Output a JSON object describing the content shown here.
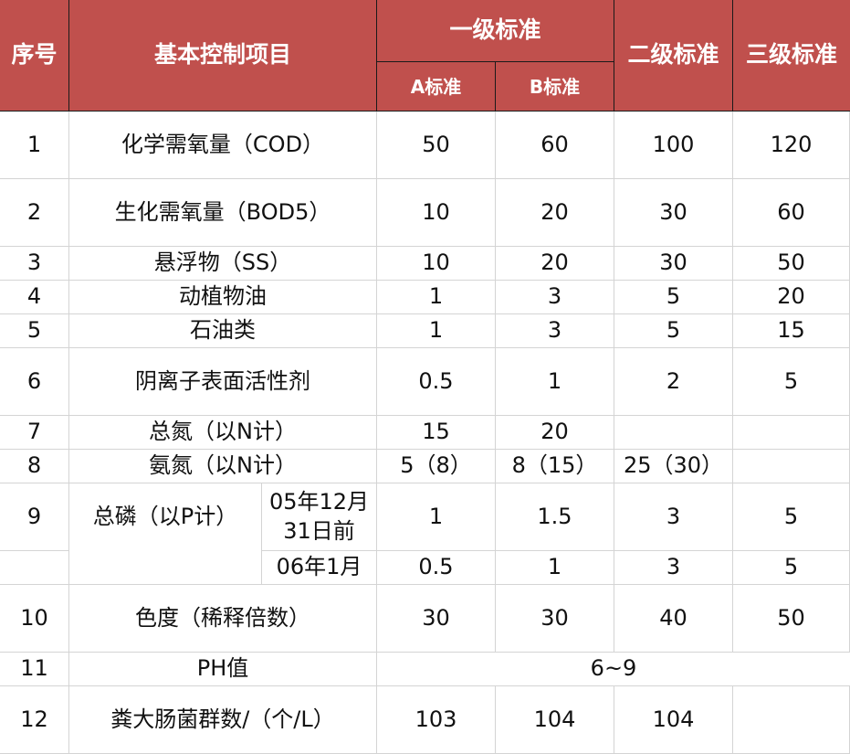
{
  "colors": {
    "header_bg": "#c0504d",
    "header_text": "#ffffff",
    "grid_line": "#d4d4d4",
    "body_text": "#111111"
  },
  "header": {
    "index": "序号",
    "item": "基本控制项目",
    "grade1": "一级标准",
    "grade1_a": "A标准",
    "grade1_b": "B标准",
    "grade2": "二级标准",
    "grade3": "三级标准"
  },
  "rows": [
    {
      "no": "1",
      "item": "化学需氧量（COD）",
      "a": "50",
      "b": "60",
      "g2": "100",
      "g3": "120"
    },
    {
      "no": "2",
      "item": "生化需氧量（BOD5）",
      "a": "10",
      "b": "20",
      "g2": "30",
      "g3": "60"
    },
    {
      "no": "3",
      "item": "悬浮物（SS）",
      "a": "10",
      "b": "20",
      "g2": "30",
      "g3": "50"
    },
    {
      "no": "4",
      "item": "动植物油",
      "a": "1",
      "b": "3",
      "g2": "5",
      "g3": "20"
    },
    {
      "no": "5",
      "item": "石油类",
      "a": "1",
      "b": "3",
      "g2": "5",
      "g3": "15"
    },
    {
      "no": "6",
      "item": "阴离子表面活性剂",
      "a": "0.5",
      "b": "1",
      "g2": "2",
      "g3": "5"
    },
    {
      "no": "7",
      "item": "总氮（以N计）",
      "a": "15",
      "b": "20",
      "g2": "",
      "g3": ""
    },
    {
      "no": "8",
      "item": "氨氮（以N计）",
      "a": "5（8）",
      "b": "8（15）",
      "g2": "25（30）",
      "g3": ""
    },
    {
      "no": "9",
      "item": "总磷（以P计）",
      "sub": "05年12月31日前",
      "a": "1",
      "b": "1.5",
      "g2": "3",
      "g3": "5"
    },
    {
      "no": "",
      "item": "",
      "sub": "06年1月",
      "a": "0.5",
      "b": "1",
      "g2": "3",
      "g3": "5"
    },
    {
      "no": "10",
      "item": "色度（稀释倍数）",
      "a": "30",
      "b": "30",
      "g2": "40",
      "g3": "50"
    },
    {
      "no": "11",
      "item": "PH值",
      "merged": "6~9"
    },
    {
      "no": "12",
      "item": "粪大肠菌群数/（个/L）",
      "a": "103",
      "b": "104",
      "g2": "104",
      "g3": ""
    }
  ]
}
